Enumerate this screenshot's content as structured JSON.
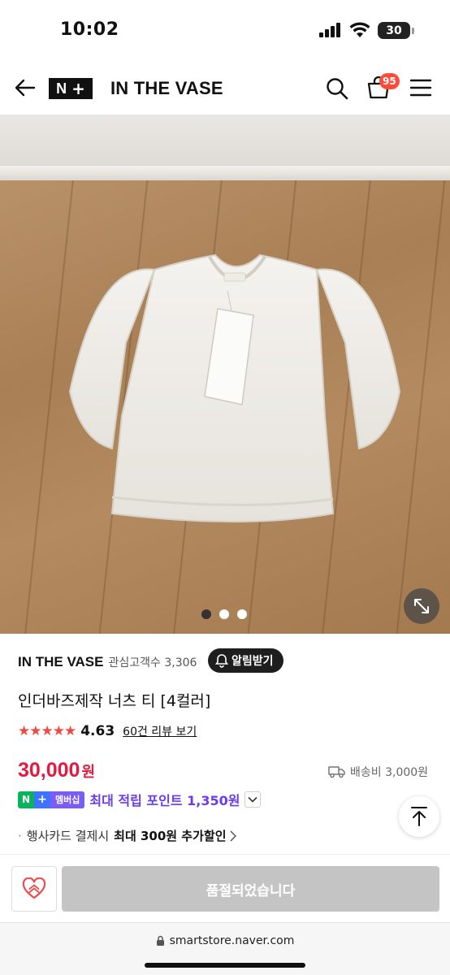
{
  "status_bar": {
    "time": "10:02",
    "battery": "30"
  },
  "header": {
    "brand": "IN THE VASE",
    "logo": "N+",
    "cart_count": "95"
  },
  "gallery": {
    "slide_count": 3,
    "active_slide": 1
  },
  "store": {
    "name": "IN THE VASE",
    "interest": "관심고객수 3,306",
    "notify_label": "알림받기"
  },
  "product": {
    "title": "인더바즈제작 너츠 티 [4컬러]",
    "rating": "4.63",
    "stars": "★★★★★",
    "review_link": "60건 리뷰 보기",
    "price": "30,000",
    "price_unit": "원",
    "shipping": "배송비 3,000원"
  },
  "points": {
    "badge_n": "N",
    "badge_plus": "+",
    "badge_membership": "멤버십",
    "text": "최대 적립 포인트 1,350원"
  },
  "card_discount": {
    "prefix": "행사카드 결제시 ",
    "bold": "최대 300원 추가할인"
  },
  "action": {
    "soldout_label": "품절되었습니다"
  },
  "browser": {
    "url": "smartstore.naver.com"
  },
  "colors": {
    "accent_red": "#e5183f",
    "point_purple": "#6a3cf0",
    "naver_green": "#07b35b"
  }
}
